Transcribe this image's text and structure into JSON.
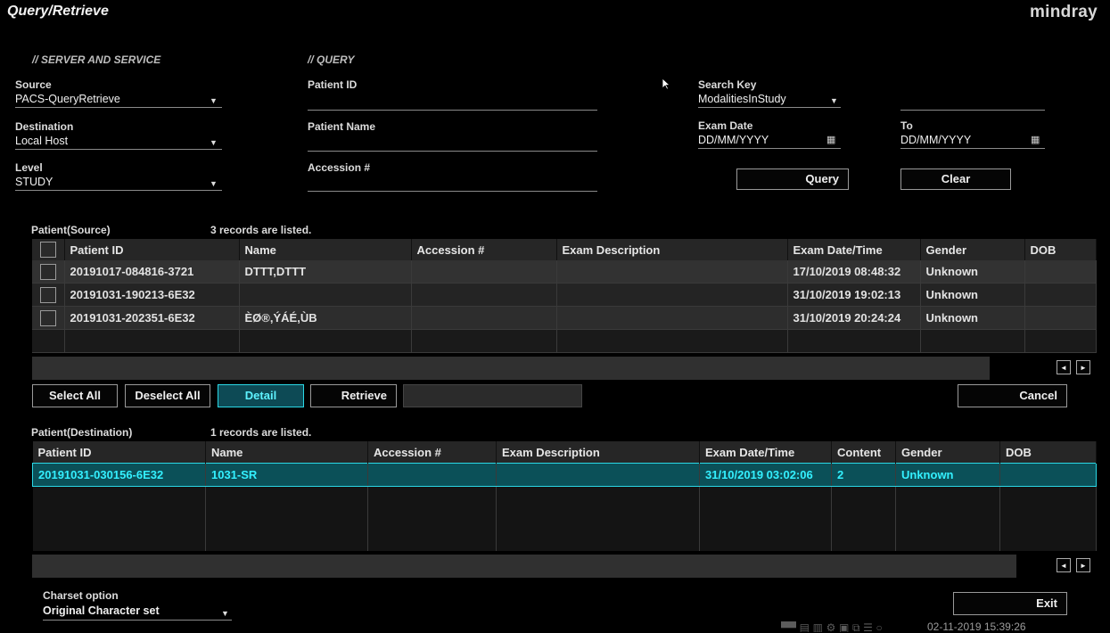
{
  "header": {
    "title": "Query/Retrieve",
    "brand": "mindray"
  },
  "server": {
    "section_title": "SERVER AND SERVICE",
    "source_label": "Source",
    "source_value": "PACS-QueryRetrieve",
    "destination_label": "Destination",
    "destination_value": "Local Host",
    "level_label": "Level",
    "level_value": "STUDY"
  },
  "query": {
    "section_title": "QUERY",
    "patient_id_label": "Patient ID",
    "patient_name_label": "Patient Name",
    "accession_label": "Accession #",
    "search_key_label": "Search Key",
    "search_key_value": "ModalitiesInStudy",
    "exam_date_label": "Exam Date",
    "exam_date_value": "DD/MM/YYYY",
    "to_label": "To",
    "to_value": "DD/MM/YYYY",
    "query_button": "Query",
    "clear_button": "Clear"
  },
  "source_table": {
    "title": "Patient(Source)",
    "count": "3 records are listed.",
    "headers": [
      "Patient ID",
      "Name",
      "Accession #",
      "Exam Description",
      "Exam Date/Time",
      "Gender",
      "DOB"
    ],
    "rows": [
      {
        "patient_id": "20191017-084816-3721",
        "name": "DTTT,DTTT",
        "accession": "",
        "description": "",
        "datetime": "17/10/2019 08:48:32",
        "gender": "Unknown",
        "dob": ""
      },
      {
        "patient_id": "20191031-190213-6E32",
        "name": "",
        "accession": "",
        "description": "",
        "datetime": "31/10/2019 19:02:13",
        "gender": "Unknown",
        "dob": ""
      },
      {
        "patient_id": "20191031-202351-6E32",
        "name": "ÈØ®,ÝÁÉ,ÙB",
        "accession": "",
        "description": "",
        "datetime": "31/10/2019 20:24:24",
        "gender": "Unknown",
        "dob": ""
      }
    ]
  },
  "actions": {
    "select_all": "Select All",
    "deselect_all": "Deselect All",
    "detail": "Detail",
    "retrieve": "Retrieve",
    "cancel": "Cancel"
  },
  "destination_table": {
    "title": "Patient(Destination)",
    "count": "1 records are listed.",
    "headers": [
      "Patient ID",
      "Name",
      "Accession #",
      "Exam Description",
      "Exam Date/Time",
      "Content",
      "Gender",
      "DOB"
    ],
    "rows": [
      {
        "patient_id": "20191031-030156-6E32",
        "name": "1031-SR",
        "accession": "",
        "description": "",
        "datetime": "31/10/2019 03:02:06",
        "content": "2",
        "gender": "Unknown",
        "dob": ""
      }
    ]
  },
  "footer": {
    "charset_label": "Charset option",
    "charset_value": "Original Character set",
    "exit_button": "Exit",
    "datetime": "02-11-2019 15:39:26"
  },
  "icons": {
    "scroll_left": "◄",
    "scroll_right": "►",
    "dropdown": "▼",
    "calendar": "calendar-icon"
  },
  "colors": {
    "accent": "#2ad8e6",
    "selected_row": "#0b5058",
    "background": "#000000"
  }
}
